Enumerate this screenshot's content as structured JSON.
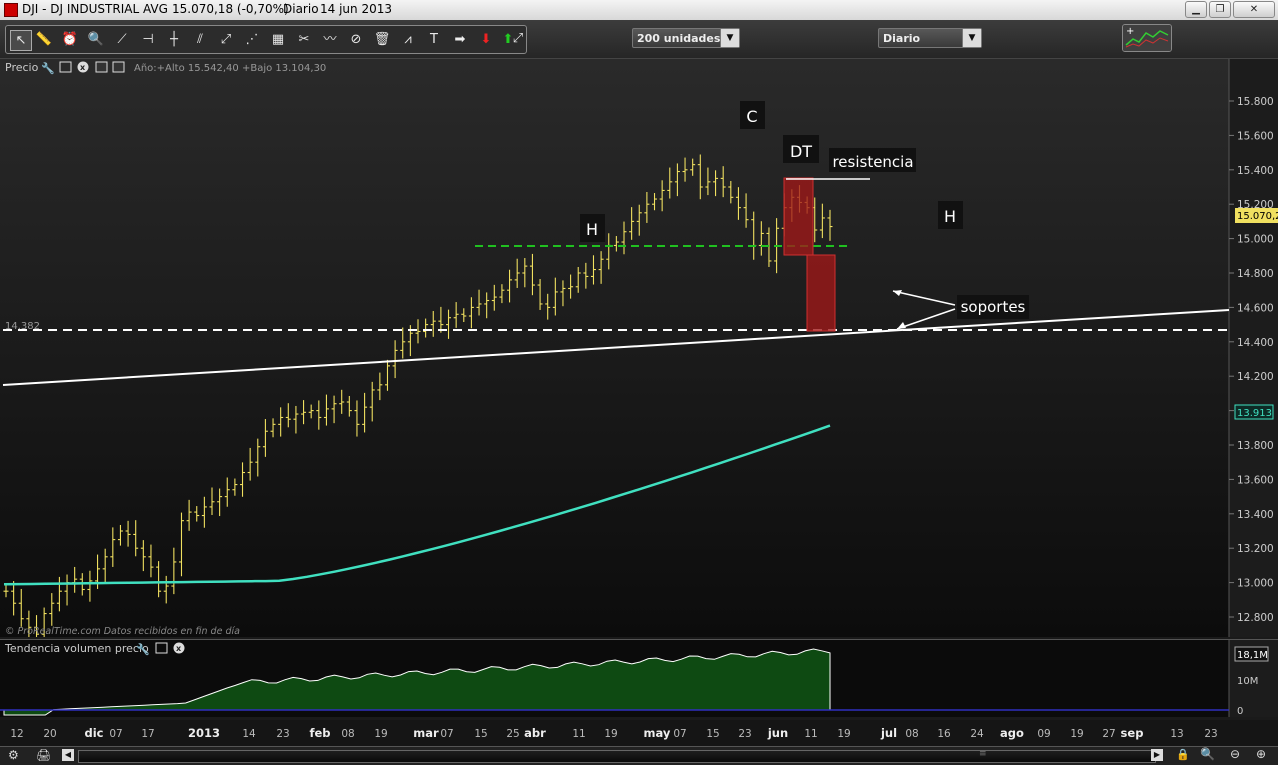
{
  "titlebar": {
    "symbol": "DJI - DJ INDUSTRIAL AVG",
    "quote": "15.070,18 (-0,70%)",
    "period": "Diario",
    "date": "14 jun 2013"
  },
  "toolbar": {
    "units_select": "200 unidades",
    "timeframe_select": "Diario"
  },
  "price_panel": {
    "label": "Precio",
    "year_info": "Año:+Alto 15.542,40 +Bajo 13.104,30",
    "credit": "© ProRealTime.com  Datos recibidos en fin de día",
    "support_level": "14.382",
    "last_price_label": "15.070,2",
    "ma_label": "13.913",
    "y_ticks": [
      "15.800",
      "15.600",
      "15.400",
      "15.200",
      "15.000",
      "14.800",
      "14.600",
      "14.400",
      "14.200",
      "14.000",
      "13.800",
      "13.600",
      "13.400",
      "13.200",
      "13.000",
      "12.800"
    ],
    "annotations": {
      "c": "C",
      "dt": "DT",
      "h_left": "H",
      "h_right": "H",
      "resistencia": "resistencia",
      "soportes": "soportes"
    }
  },
  "volume_panel": {
    "label": "Tendencia volumen precio",
    "last_value": "18,1M",
    "ticks": [
      "10M",
      "0"
    ]
  },
  "x_axis": {
    "labels": [
      "12",
      "20",
      "dic",
      "07",
      "17",
      "2013",
      "14",
      "23",
      "feb",
      "08",
      "19",
      "mar",
      "07",
      "15",
      "25",
      "abr",
      "11",
      "19",
      "may",
      "07",
      "15",
      "23",
      "jun",
      "11",
      "19",
      "jul",
      "08",
      "16",
      "24",
      "ago",
      "09",
      "19",
      "27",
      "sep",
      "13",
      "23"
    ]
  },
  "colors": {
    "candles": "#f0e060",
    "moving_average": "#40e0c0",
    "volume_fill": "#0e4a12",
    "neckline": "#20c020",
    "zone": "#a01818"
  },
  "chart_data": {
    "type": "ohlc",
    "moving_average_period": 200,
    "y_range": [
      12700,
      15900
    ],
    "last_close": 15070.18,
    "support_level": 14382,
    "year_high": 15542.4,
    "year_low": 13104.3,
    "ma_last": 13913,
    "closes_approx": [
      12950,
      12880,
      12790,
      12740,
      12700,
      12820,
      12880,
      12950,
      13000,
      13020,
      12960,
      13010,
      13080,
      13150,
      13250,
      13300,
      13280,
      13200,
      13150,
      13090,
      12950,
      12980,
      13120,
      13360,
      13410,
      13390,
      13440,
      13470,
      13500,
      13540,
      13570,
      13640,
      13700,
      13790,
      13880,
      13920,
      13960,
      13950,
      13980,
      13990,
      14000,
      13960,
      14010,
      14040,
      14050,
      14000,
      13920,
      14020,
      14120,
      14150,
      14260,
      14350,
      14400,
      14450,
      14460,
      14500,
      14520,
      14500,
      14540,
      14560,
      14550,
      14600,
      14620,
      14640,
      14660,
      14700,
      14760,
      14800,
      14840,
      14730,
      14620,
      14600,
      14690,
      14710,
      14720,
      14800,
      14780,
      14820,
      14880,
      14960,
      14980,
      15040,
      15100,
      15150,
      15200,
      15230,
      15280,
      15330,
      15390,
      15400,
      15430,
      15300,
      15330,
      15350,
      15300,
      15240,
      15180,
      15110,
      14960,
      15030,
      14870,
      15060,
      15180,
      15240,
      15210,
      15180,
      15050,
      15120,
      15070
    ]
  }
}
